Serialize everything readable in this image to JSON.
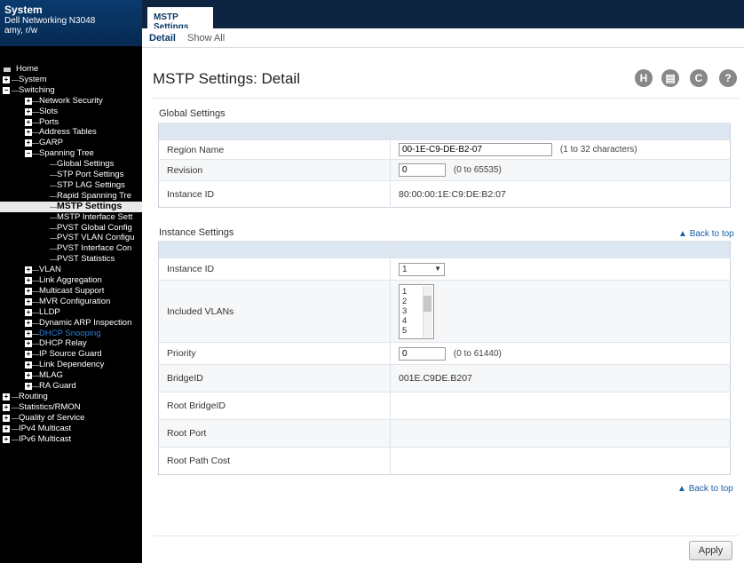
{
  "system": {
    "title": "System",
    "device": "Dell Networking N3048",
    "user": "amy, r/w"
  },
  "tabs": {
    "active": "MSTP Settings",
    "sub": [
      "Detail",
      "Show All"
    ]
  },
  "page": {
    "title": "MSTP Settings: Detail"
  },
  "toolbar_icons": [
    "save-icon",
    "print-icon",
    "refresh-icon",
    "help-icon"
  ],
  "nav": [
    {
      "label": "Home",
      "level": 0,
      "toggle": "",
      "icon": "home-icon"
    },
    {
      "label": "System",
      "level": 0,
      "toggle": "+"
    },
    {
      "label": "Switching",
      "level": 0,
      "toggle": "-"
    },
    {
      "label": "Network Security",
      "level": 1,
      "toggle": "+"
    },
    {
      "label": "Slots",
      "level": 1,
      "toggle": "+"
    },
    {
      "label": "Ports",
      "level": 1,
      "toggle": "+"
    },
    {
      "label": "Address Tables",
      "level": 1,
      "toggle": "+"
    },
    {
      "label": "GARP",
      "level": 1,
      "toggle": "+"
    },
    {
      "label": "Spanning Tree",
      "level": 1,
      "toggle": "-"
    },
    {
      "label": "Global Settings",
      "level": 2,
      "toggle": ""
    },
    {
      "label": "STP Port Settings",
      "level": 2,
      "toggle": ""
    },
    {
      "label": "STP LAG Settings",
      "level": 2,
      "toggle": ""
    },
    {
      "label": "Rapid Spanning Tre",
      "level": 2,
      "toggle": ""
    },
    {
      "label": "MSTP Settings",
      "level": 2,
      "toggle": "",
      "current": true
    },
    {
      "label": "MSTP Interface Sett",
      "level": 2,
      "toggle": ""
    },
    {
      "label": "PVST Global Config",
      "level": 2,
      "toggle": ""
    },
    {
      "label": "PVST VLAN Configu",
      "level": 2,
      "toggle": ""
    },
    {
      "label": "PVST Interface Con",
      "level": 2,
      "toggle": ""
    },
    {
      "label": "PVST Statistics",
      "level": 2,
      "toggle": ""
    },
    {
      "label": "VLAN",
      "level": 1,
      "toggle": "+"
    },
    {
      "label": "Link Aggregation",
      "level": 1,
      "toggle": "+"
    },
    {
      "label": "Multicast Support",
      "level": 1,
      "toggle": "+"
    },
    {
      "label": "MVR Configuration",
      "level": 1,
      "toggle": "+"
    },
    {
      "label": "LLDP",
      "level": 1,
      "toggle": "+"
    },
    {
      "label": "Dynamic ARP Inspection",
      "level": 1,
      "toggle": "+"
    },
    {
      "label": "DHCP Snooping",
      "level": 1,
      "toggle": "+",
      "highlight": true
    },
    {
      "label": "DHCP Relay",
      "level": 1,
      "toggle": "+"
    },
    {
      "label": "IP Source Guard",
      "level": 1,
      "toggle": "+"
    },
    {
      "label": "Link Dependency",
      "level": 1,
      "toggle": "+"
    },
    {
      "label": "MLAG",
      "level": 1,
      "toggle": "+"
    },
    {
      "label": "RA Guard",
      "level": 1,
      "toggle": "+"
    },
    {
      "label": "Routing",
      "level": 0,
      "toggle": "+"
    },
    {
      "label": "Statistics/RMON",
      "level": 0,
      "toggle": "+"
    },
    {
      "label": "Quality of Service",
      "level": 0,
      "toggle": "+"
    },
    {
      "label": "IPv4 Multicast",
      "level": 0,
      "toggle": "+"
    },
    {
      "label": "IPv6 Multicast",
      "level": 0,
      "toggle": "+"
    }
  ],
  "global": {
    "title": "Global Settings",
    "region_label": "Region Name",
    "region_value": "00-1E-C9-DE-B2-07",
    "region_hint": "(1 to 32 characters)",
    "revision_label": "Revision",
    "revision_value": "0",
    "revision_hint": "(0 to 65535)",
    "instance_id_label": "Instance ID",
    "instance_id_value": "80:00:00:1E:C9:DE:B2:07"
  },
  "instance": {
    "title": "Instance Settings",
    "back_link": "Back to top",
    "id_label": "Instance ID",
    "id_value": "1",
    "vlans_label": "Included VLANs",
    "vlans": [
      "1",
      "2",
      "3",
      "4",
      "5"
    ],
    "priority_label": "Priority",
    "priority_value": "0",
    "priority_hint": "(0 to 61440)",
    "bridgeid_label": "BridgeID",
    "bridgeid_value": "001E.C9DE.B207",
    "root_bridgeid_label": "Root BridgeID",
    "root_bridgeid_value": "",
    "root_port_label": "Root Port",
    "root_port_value": "",
    "root_path_cost_label": "Root Path Cost",
    "root_path_cost_value": ""
  },
  "bottom_back_link": "Back to top",
  "apply_label": "Apply"
}
